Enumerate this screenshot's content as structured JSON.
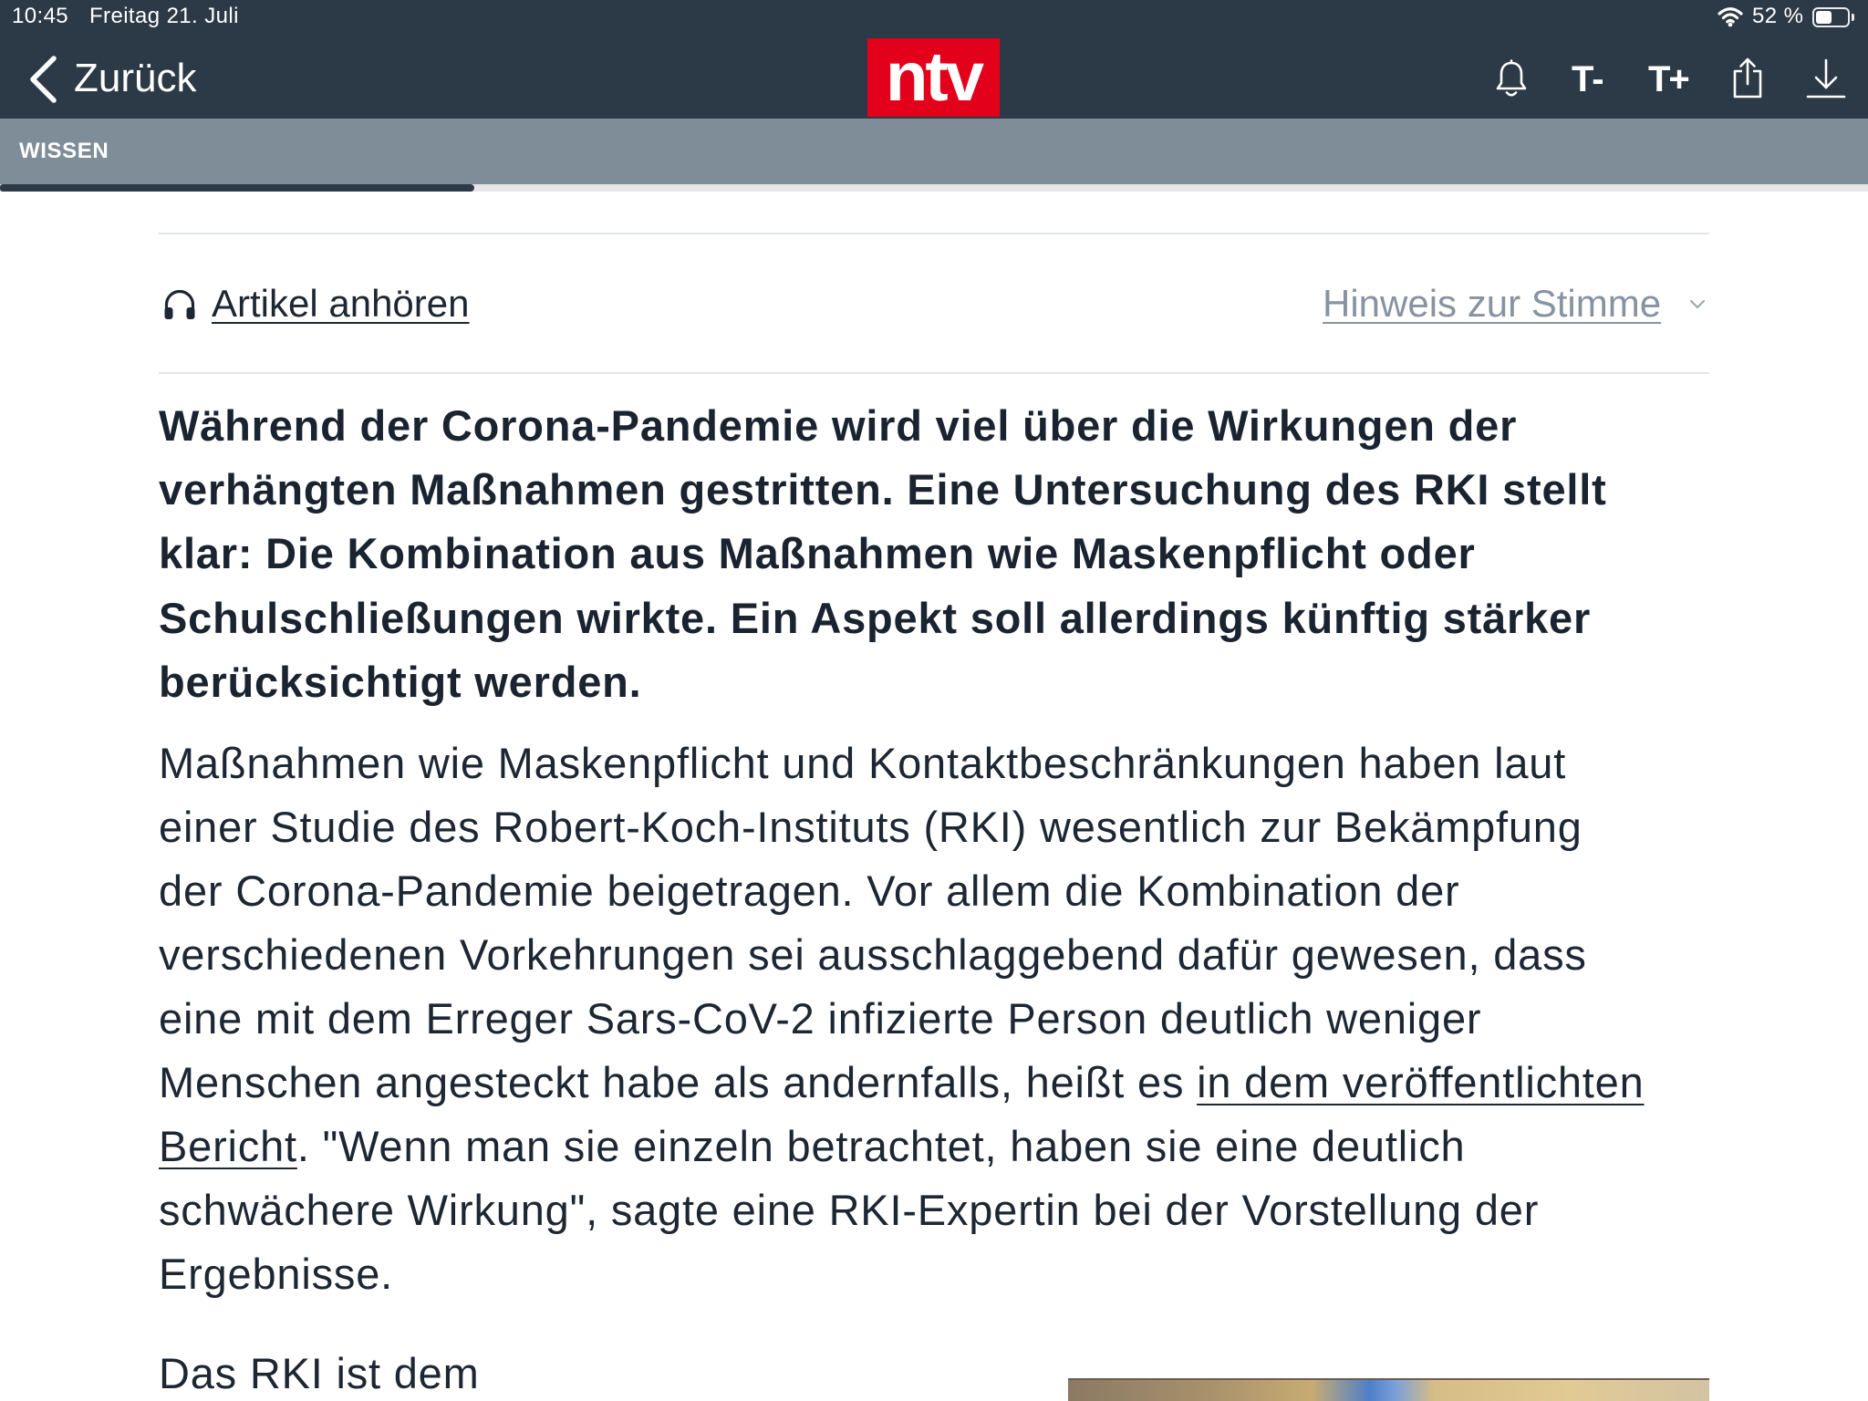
{
  "status_bar": {
    "time": "10:45",
    "date": "Freitag 21. Juli",
    "battery_text": "52 %",
    "battery_level": 0.52
  },
  "header": {
    "back_label": "Zurück",
    "logo_text": "ntv",
    "font_smaller_label": "T-",
    "font_larger_label": "T+"
  },
  "icons": {
    "back": "chevron-left-icon",
    "notifications": "bell-icon",
    "share": "share-icon",
    "download": "download-icon",
    "listen": "headphones-icon",
    "voice_hint": "chevron-down-icon",
    "wifi": "wifi-icon",
    "battery": "battery-icon"
  },
  "section": {
    "label": "WISSEN",
    "reading_progress": 0.254
  },
  "audio": {
    "listen_label": "Artikel anhören",
    "voice_hint_label": "Hinweis zur Stimme"
  },
  "article": {
    "lead_lines": [
      "Während der Corona-Pandemie wird viel über die Wirkungen der",
      "verhängten Maßnahmen gestritten. Eine Untersuchung des RKI stellt",
      "klar: Die Kombination aus Maßnahmen wie Maskenpflicht oder",
      "Schulschließungen wirkte. Ein Aspekt soll allerdings künftig stärker",
      "berücksichtigt werden."
    ],
    "paragraph_1": {
      "lines": [
        {
          "text": "Maßnahmen wie Maskenpflicht und Kontaktbeschränkungen haben laut"
        },
        {
          "text": "einer Studie des Robert-Koch-Instituts (RKI) wesentlich zur Bekämpfung"
        },
        {
          "text": "der Corona-Pandemie beigetragen. Vor allem die Kombination der"
        },
        {
          "text": "verschiedenen Vorkehrungen sei ausschlaggebend dafür gewesen, dass"
        },
        {
          "text": "eine mit dem Erreger Sars-CoV-2 infizierte Person deutlich weniger"
        },
        {
          "text_before": "Menschen angesteckt habe als andernfalls, heißt es ",
          "link": "in dem veröffentlichten"
        },
        {
          "link": "Bericht",
          "text_after": ". \"Wenn man sie einzeln betrachtet, haben sie eine deutlich"
        },
        {
          "text": "schwächere Wirkung\", sagte eine RKI-Expertin bei der Vorstellung der"
        },
        {
          "text": "Ergebnisse."
        }
      ]
    },
    "paragraph_2_lines": [
      "Das RKI ist dem"
    ]
  },
  "colors": {
    "header_bg": "#2c3a47",
    "section_bg": "#7f8d99",
    "logo_red": "#e3001b",
    "text": "#1d2733",
    "muted": "#8793a0"
  }
}
